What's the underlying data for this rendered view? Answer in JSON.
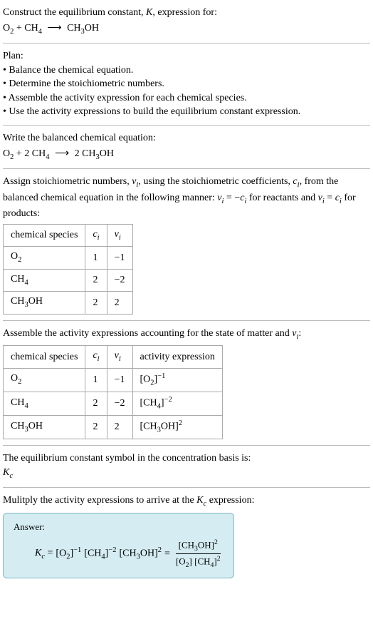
{
  "header": {
    "title": "Construct the equilibrium constant, ",
    "title_k": "K",
    "title_suffix": ", expression for:"
  },
  "eq_unbalanced": {
    "r1": "O",
    "r1_sub": "2",
    "r2": "CH",
    "r2_sub": "4",
    "arrow": "⟶",
    "p1a": "CH",
    "p1a_sub": "3",
    "p1b": "OH"
  },
  "plan": {
    "label": "Plan:",
    "items": [
      "Balance the chemical equation.",
      "Determine the stoichiometric numbers.",
      "Assemble the activity expression for each chemical species.",
      "Use the activity expressions to build the equilibrium constant expression."
    ]
  },
  "balanced": {
    "label": "Write the balanced chemical equation:",
    "r1": "O",
    "r1_sub": "2",
    "r2_coef": "2",
    "r2": "CH",
    "r2_sub": "4",
    "arrow": "⟶",
    "p1_coef": "2",
    "p1a": "CH",
    "p1a_sub": "3",
    "p1b": "OH"
  },
  "stoich": {
    "text_a": "Assign stoichiometric numbers, ",
    "nu": "ν",
    "nu_sub": "i",
    "text_b": ", using the stoichiometric coefficients, ",
    "c": "c",
    "c_sub": "i",
    "text_c": ", from the balanced chemical equation in the following manner: ",
    "rel1_lhs": "ν",
    "rel1_lhs_sub": "i",
    "rel1_eq": " = −",
    "rel1_rhs": "c",
    "rel1_rhs_sub": "i",
    "text_d": " for reactants and ",
    "rel2_lhs": "ν",
    "rel2_lhs_sub": "i",
    "rel2_eq": " = ",
    "rel2_rhs": "c",
    "rel2_rhs_sub": "i",
    "text_e": " for products:"
  },
  "table1": {
    "h1": "chemical species",
    "h2": "c",
    "h2_sub": "i",
    "h3": "ν",
    "h3_sub": "i",
    "rows": [
      {
        "sp_a": "O",
        "sp_a_sub": "2",
        "sp_b": "",
        "sp_b_sub": "",
        "c": "1",
        "nu": "−1"
      },
      {
        "sp_a": "CH",
        "sp_a_sub": "4",
        "sp_b": "",
        "sp_b_sub": "",
        "c": "2",
        "nu": "−2"
      },
      {
        "sp_a": "CH",
        "sp_a_sub": "3",
        "sp_b": "OH",
        "sp_b_sub": "",
        "c": "2",
        "nu": "2"
      }
    ]
  },
  "activity": {
    "text_a": "Assemble the activity expressions accounting for the state of matter and ",
    "nu": "ν",
    "nu_sub": "i",
    "text_b": ":"
  },
  "table2": {
    "h1": "chemical species",
    "h2": "c",
    "h2_sub": "i",
    "h3": "ν",
    "h3_sub": "i",
    "h4": "activity expression",
    "rows": [
      {
        "sp_a": "O",
        "sp_a_sub": "2",
        "sp_b": "",
        "c": "1",
        "nu": "−1",
        "ae_a": "[O",
        "ae_a_sub": "2",
        "ae_b": "]",
        "ae_exp": "−1"
      },
      {
        "sp_a": "CH",
        "sp_a_sub": "4",
        "sp_b": "",
        "c": "2",
        "nu": "−2",
        "ae_a": "[CH",
        "ae_a_sub": "4",
        "ae_b": "]",
        "ae_exp": "−2"
      },
      {
        "sp_a": "CH",
        "sp_a_sub": "3",
        "sp_b": "OH",
        "c": "2",
        "nu": "2",
        "ae_a": "[CH",
        "ae_a_sub": "3",
        "ae_b": "OH]",
        "ae_exp": "2"
      }
    ]
  },
  "basis": {
    "text": "The equilibrium constant symbol in the concentration basis is:",
    "k": "K",
    "k_sub": "c"
  },
  "multiply": {
    "text_a": "Mulitply the activity expressions to arrive at the ",
    "k": "K",
    "k_sub": "c",
    "text_b": " expression:"
  },
  "answer": {
    "label": "Answer:",
    "lhs_k": "K",
    "lhs_k_sub": "c",
    "eq": " = ",
    "t1_a": "[O",
    "t1_sub": "2",
    "t1_b": "]",
    "t1_exp": "−1",
    "t2_a": "[CH",
    "t2_sub": "4",
    "t2_b": "]",
    "t2_exp": "−2",
    "t3_a": "[CH",
    "t3_sub": "3",
    "t3_b": "OH]",
    "t3_exp": "2",
    "eq2": " = ",
    "num_a": "[CH",
    "num_sub": "3",
    "num_b": "OH]",
    "num_exp": "2",
    "den1_a": "[O",
    "den1_sub": "2",
    "den1_b": "]",
    "den2_a": "[CH",
    "den2_sub": "4",
    "den2_b": "]",
    "den2_exp": "2"
  }
}
